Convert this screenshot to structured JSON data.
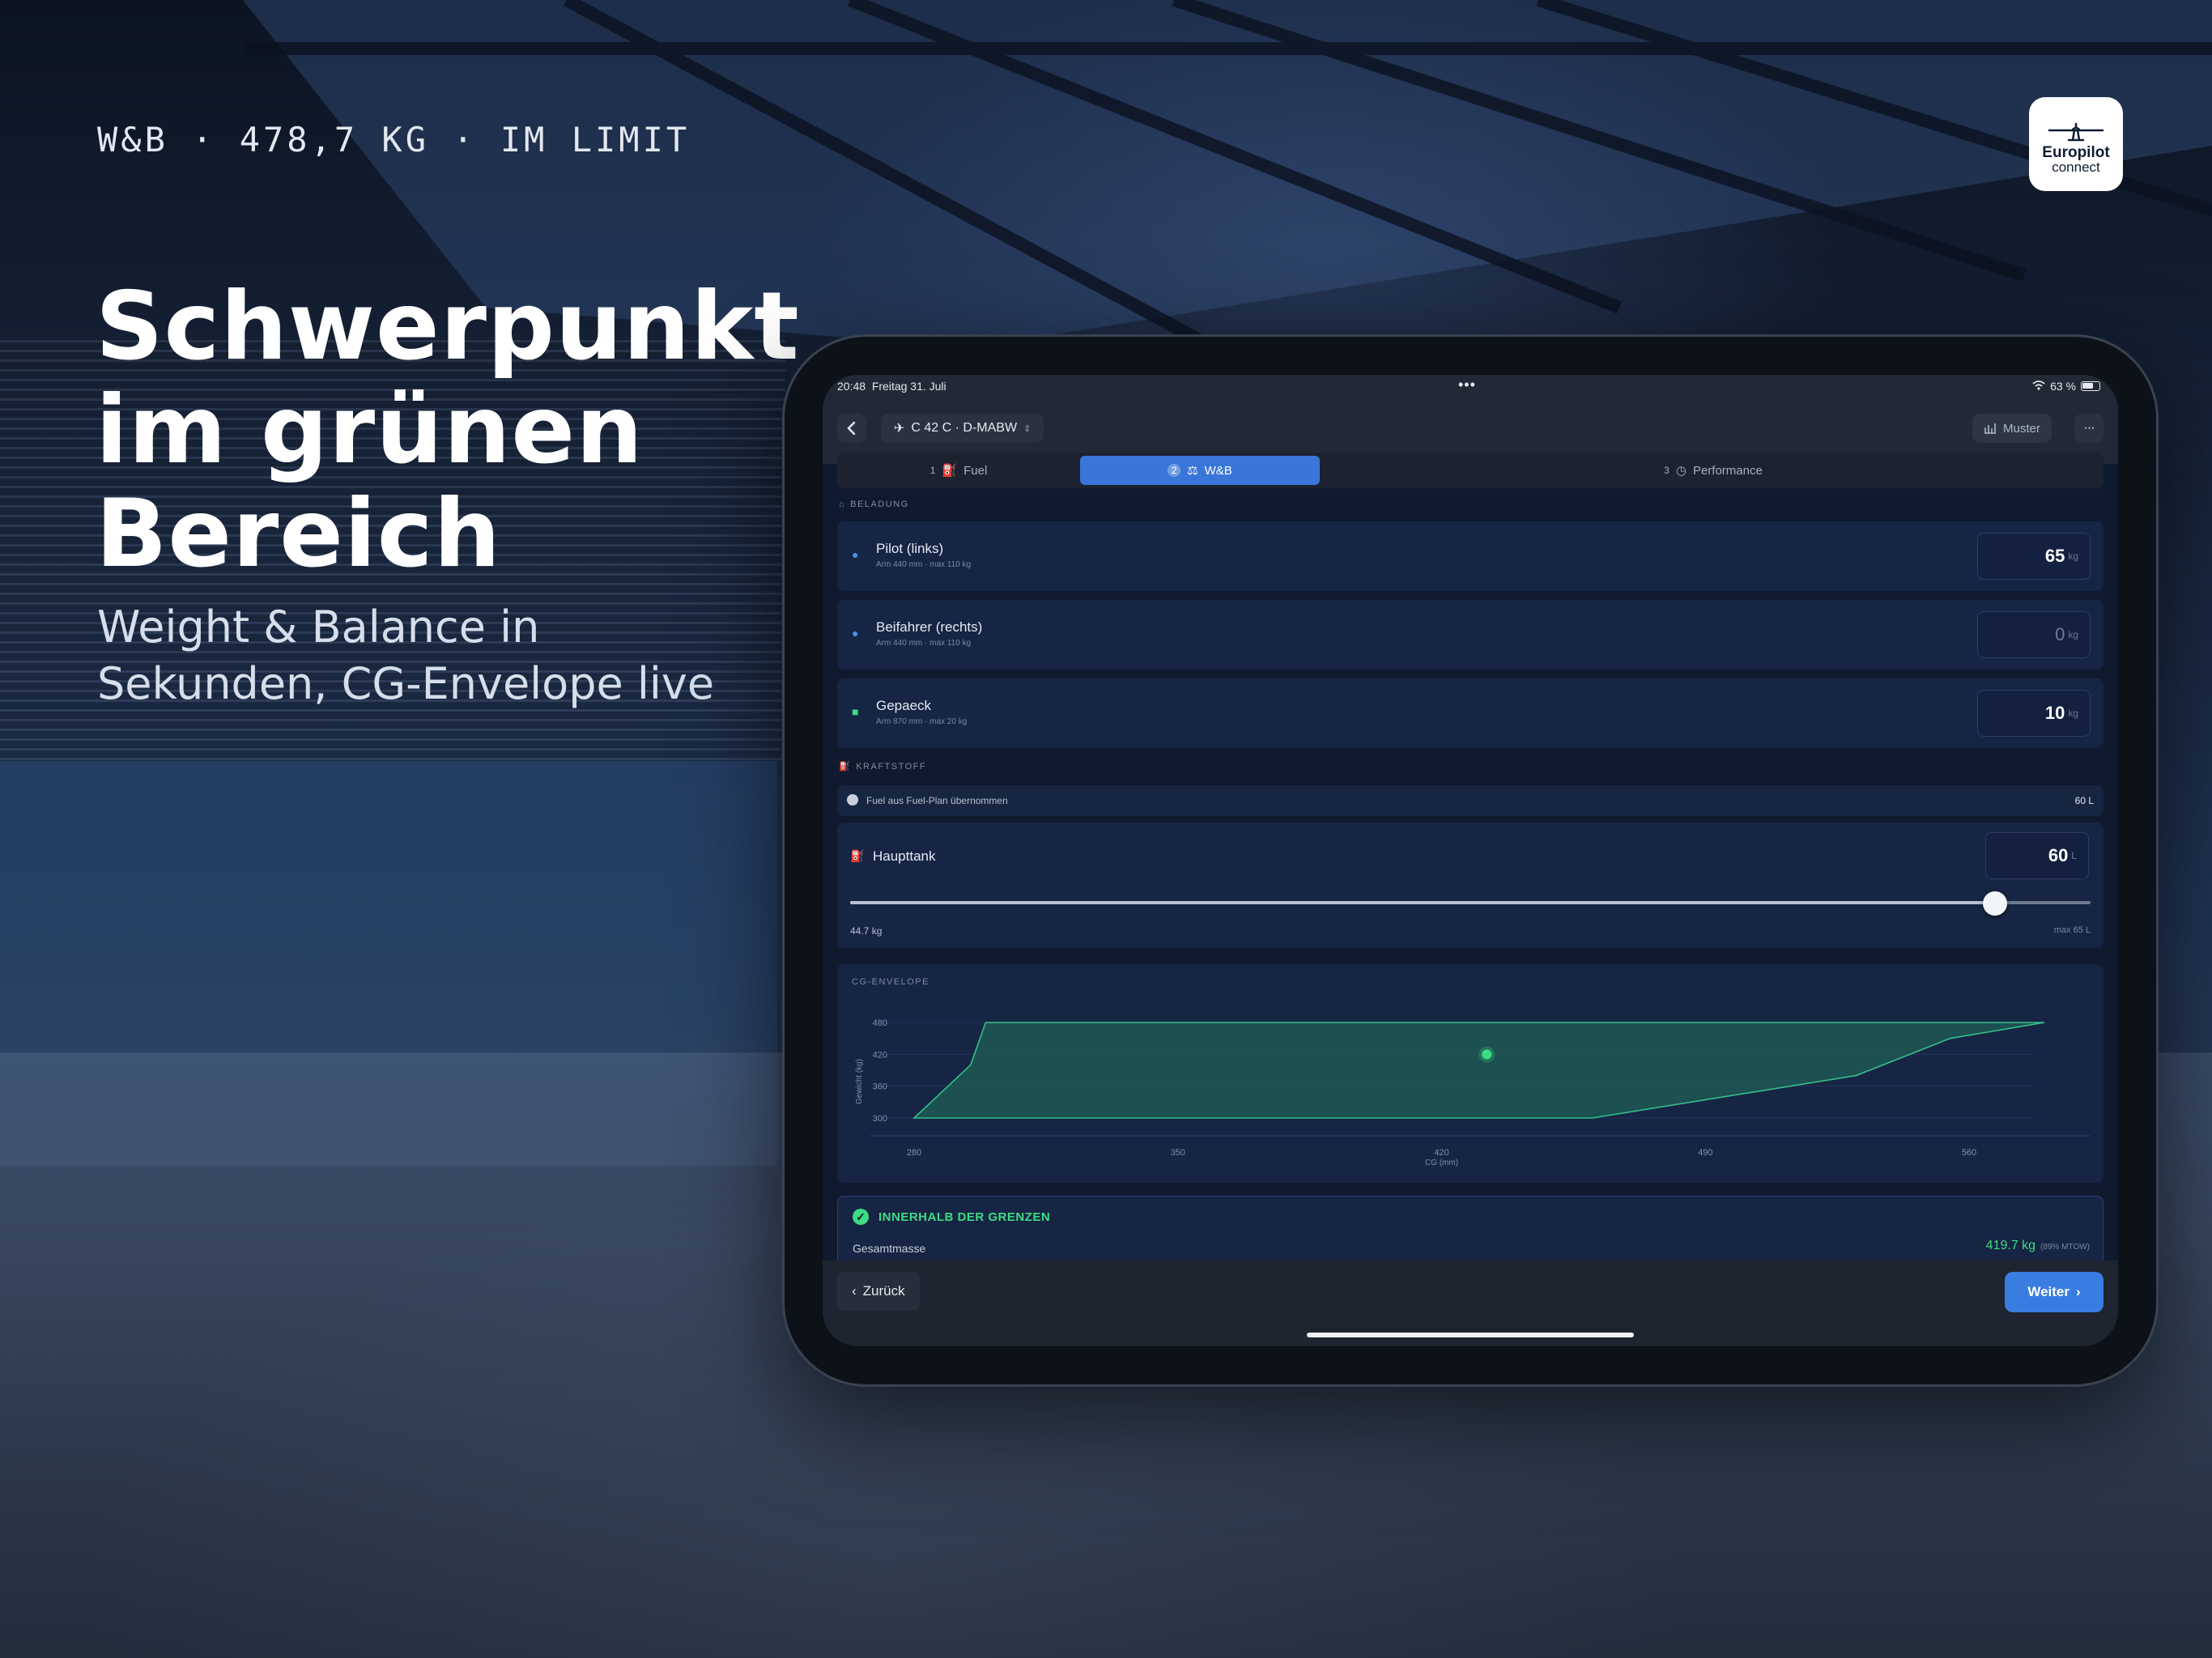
{
  "hero": {
    "tag": "W&B · 478,7 KG · IM LIMIT",
    "headline_line1": "Schwerpunkt",
    "headline_line2": "im grünen",
    "headline_line3": "Bereich",
    "subline_line1": "Weight & Balance in",
    "subline_line2": "Sekunden, CG-Envelope live"
  },
  "logo": {
    "brand": "Europilot",
    "sub": "connect",
    "icon": "airplane-icon"
  },
  "status_bar": {
    "time": "20:48",
    "date": "Freitag 31. Juli",
    "battery": "63 %"
  },
  "nav": {
    "aircraft": "C 42 C · D-MABW",
    "muster_label": "Muster",
    "more_label": "···"
  },
  "steps": [
    {
      "num": "1",
      "label": "Fuel",
      "active": false
    },
    {
      "num": "2",
      "label": "W&B",
      "active": true
    },
    {
      "num": "3",
      "label": "Performance",
      "active": false
    }
  ],
  "beladung": {
    "label": "BELADUNG",
    "items": [
      {
        "name": "Pilot (links)",
        "sub": "Arm 440 mm · max 110 kg",
        "value": "65",
        "unit": "kg",
        "icon": "person-icon"
      },
      {
        "name": "Beifahrer (rechts)",
        "sub": "Arm 440 mm · max 110 kg",
        "value": "0",
        "unit": "kg",
        "icon": "person-icon"
      },
      {
        "name": "Gepaeck",
        "sub": "Arm 870 mm · max 20 kg",
        "value": "10",
        "unit": "kg",
        "icon": "luggage-icon"
      }
    ]
  },
  "kraftstoff": {
    "label": "KRAFTSTOFF",
    "from_plan_label": "Fuel aus Fuel-Plan übernommen",
    "from_plan_value": "60 L",
    "tank_name": "Haupttank",
    "tank_value": "60",
    "tank_unit": "L",
    "tank_weight": "44.7 kg",
    "tank_max": "max 65 L",
    "fill_fraction": 0.923
  },
  "envelope": {
    "label": "CG-ENVELOPE",
    "ylabel": "Gewicht (kg)",
    "xlabel": "CG (mm)"
  },
  "chart_data": {
    "type": "area",
    "title": "CG-ENVELOPE",
    "xlabel": "CG (mm)",
    "ylabel": "Gewicht (kg)",
    "xlim": [
      280,
      560
    ],
    "ylim": [
      300,
      480
    ],
    "x_ticks": [
      280,
      350,
      420,
      490,
      560
    ],
    "y_ticks": [
      300,
      360,
      420,
      480
    ],
    "envelope_polygon": {
      "x": [
        280,
        295,
        299,
        580,
        555,
        530,
        460,
        320,
        280
      ],
      "y": [
        300,
        400,
        480,
        480,
        450,
        380,
        300,
        300,
        300
      ]
    },
    "current_point": {
      "x": 432,
      "y": 420
    },
    "colors": {
      "envelope_fill": "#1f5b54",
      "envelope_line": "#34c08a",
      "point": "#3ddc84"
    }
  },
  "result": {
    "status": "INNERHALB DER GRENZEN",
    "mass_label": "Gesamtmasse",
    "mass_value": "419.7 kg",
    "mass_pct": "(89% MTOW)",
    "status_color": "#3ddc84"
  },
  "footer": {
    "back_label": "Zurück",
    "next_label": "Weiter"
  }
}
